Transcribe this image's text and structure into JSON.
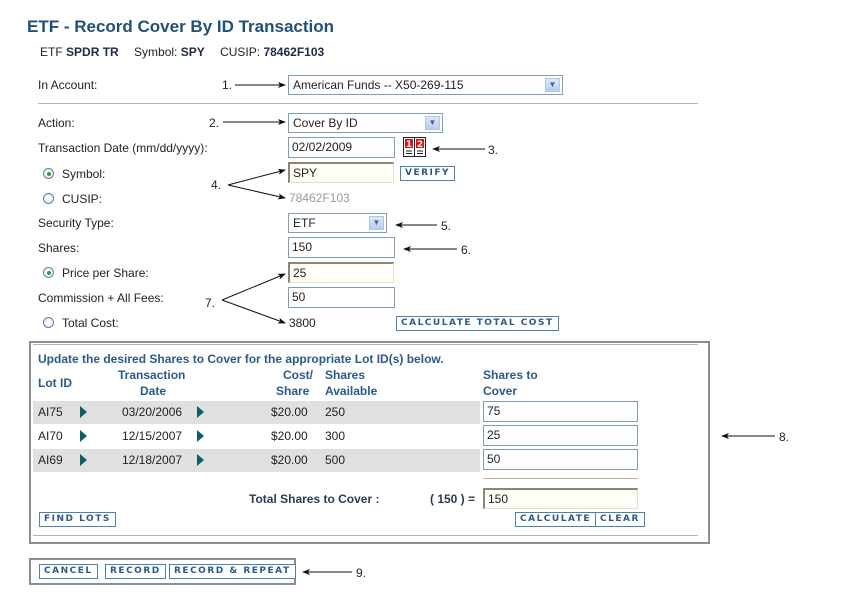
{
  "page": {
    "title": "ETF - Record Cover By ID Transaction",
    "security_line": {
      "type_prefix": "ETF",
      "name": "SPDR TR",
      "symbol_label": "Symbol:",
      "symbol": "SPY",
      "cusip_label": "CUSIP:",
      "cusip": "78462F103"
    }
  },
  "form": {
    "account": {
      "label": "In Account:",
      "value": "American Funds -- X50-269-115"
    },
    "action": {
      "label": "Action:",
      "value": "Cover By ID"
    },
    "transaction_date": {
      "label": "Transaction Date (mm/dd/yyyy):",
      "value": "02/02/2009"
    },
    "symbol": {
      "label": "Symbol:",
      "value": "SPY",
      "selected": true
    },
    "verify_button": "VERIFY",
    "cusip": {
      "label": "CUSIP:",
      "value": "78462F103",
      "selected": false
    },
    "security_type": {
      "label": "Security Type:",
      "value": "ETF"
    },
    "shares": {
      "label": "Shares:",
      "value": "150"
    },
    "price_per_share": {
      "label": "Price per Share:",
      "value": "25",
      "selected": true
    },
    "commission": {
      "label": "Commission + All Fees:",
      "value": "50"
    },
    "total_cost": {
      "label": "Total Cost:",
      "value": "3800",
      "selected": false
    },
    "calculate_total_cost_button": "CALCULATE TOTAL COST"
  },
  "lots": {
    "instruction": "Update the desired Shares to Cover for the appropriate Lot ID(s) below.",
    "headers": {
      "lot_id": "Lot ID",
      "transaction_date_1": "Transaction",
      "transaction_date_2": "Date",
      "cost_1": "Cost/",
      "cost_2": "Share",
      "available_1": "Shares",
      "available_2": "Available",
      "cover_1": "Shares to",
      "cover_2": "Cover"
    },
    "rows": [
      {
        "lot_id": "AI75",
        "date": "03/20/2006",
        "cost": "$20.00",
        "available": "250",
        "cover": "75"
      },
      {
        "lot_id": "AI70",
        "date": "12/15/2007",
        "cost": "$20.00",
        "available": "300",
        "cover": "25"
      },
      {
        "lot_id": "AI69",
        "date": "12/18/2007",
        "cost": "$20.00",
        "available": "500",
        "cover": "50"
      }
    ],
    "total_label": "Total Shares to Cover :",
    "total_expected": "( 150 ) =",
    "total_value": "150",
    "find_lots_button": "FIND LOTS",
    "calculate_button": "CALCULATE",
    "clear_button": "CLEAR"
  },
  "actions": {
    "cancel": "CANCEL",
    "record": "RECORD",
    "record_repeat": "RECORD & REPEAT"
  },
  "annotations": {
    "n1": "1.",
    "n2": "2.",
    "n3": "3.",
    "n4": "4.",
    "n5": "5.",
    "n6": "6.",
    "n7": "7.",
    "n8": "8.",
    "n9": "9."
  },
  "icons": {
    "calendar": "calendar-icon",
    "dropdown": "chevron-down-icon",
    "row_arrow": "triangle-right-icon"
  }
}
